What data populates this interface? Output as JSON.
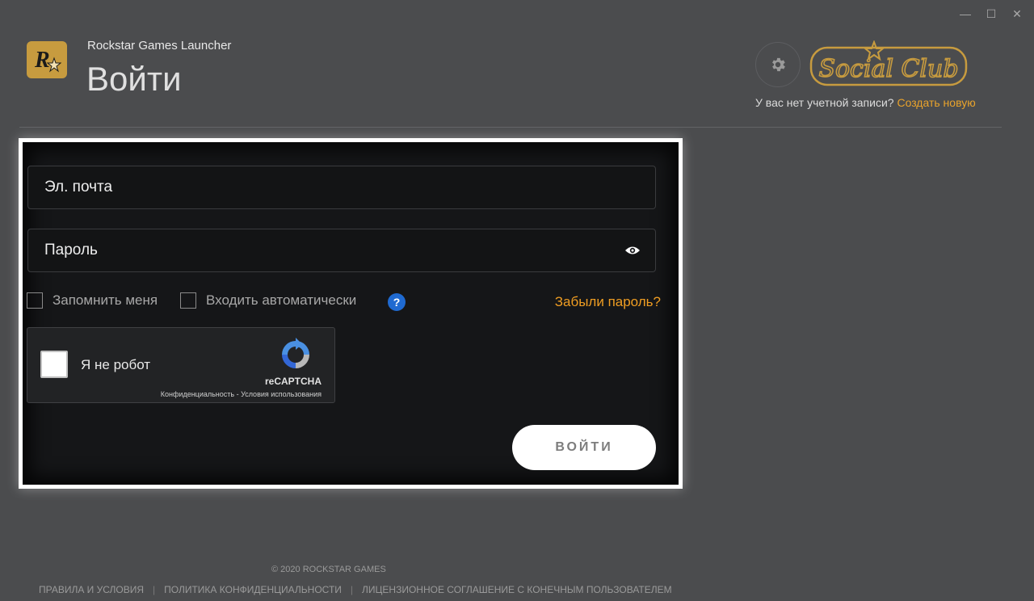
{
  "window": {
    "controls": [
      "—",
      "☐",
      "✕"
    ]
  },
  "header": {
    "app_name": "Rockstar Games Launcher",
    "title": "Войти",
    "logo_icon": "rockstar-logo",
    "settings_icon": "gear-icon",
    "social_club_logo": "Social Club",
    "no_account_text": "У вас нет учетной записи?",
    "create_account_link": "Создать новую"
  },
  "form": {
    "email_placeholder": "Эл. почта",
    "password_placeholder": "Пароль",
    "show_password_icon": "eye-icon",
    "remember_me": "Запомнить меня",
    "auto_login": "Входить автоматически",
    "help_symbol": "?",
    "forgot_password": "Забыли пароль?",
    "submit_label": "ВОЙТИ"
  },
  "captcha": {
    "label": "Я не робот",
    "brand": "reCAPTCHA",
    "privacy": "Конфиденциальность",
    "separator": " - ",
    "terms": "Условия использования"
  },
  "footer": {
    "copyright": "© 2020 ROCKSTAR GAMES",
    "links": [
      "ПРАВИЛА И УСЛОВИЯ",
      "ПОЛИТИКА КОНФИДЕНЦИАЛЬНОСТИ",
      "ЛИЦЕНЗИОННОЕ СОГЛАШЕНИЕ С КОНЕЧНЫМ ПОЛЬЗОВАТЕЛЕМ"
    ],
    "separator": "|"
  },
  "colors": {
    "background": "#4b4c4e",
    "accent": "#e9a32c",
    "panel": "#151618",
    "help_blue": "#1f6ad1"
  }
}
